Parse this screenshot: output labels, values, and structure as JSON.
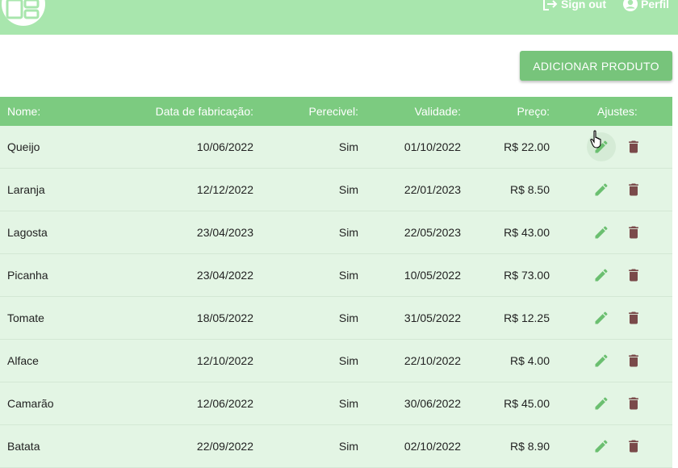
{
  "header": {
    "signout_label": "Sign out",
    "perfil_label": "Perfil",
    "colors": {
      "bar": "#a8e6ad",
      "accent": "#77c47b"
    }
  },
  "toolbar": {
    "add_label": "ADICIONAR PRODUTO"
  },
  "table": {
    "headers": {
      "nome": "Nome:",
      "fabricacao": "Data de fabricação:",
      "perecivel": "Perecivel:",
      "validade": "Validade:",
      "preco": "Preço:",
      "ajustes": "Ajustes:"
    },
    "rows": [
      {
        "nome": "Queijo",
        "fabricacao": "10/06/2022",
        "perecivel": "Sim",
        "validade": "01/10/2022",
        "preco": "R$ 22.00"
      },
      {
        "nome": "Laranja",
        "fabricacao": "12/12/2022",
        "perecivel": "Sim",
        "validade": "22/01/2023",
        "preco": "R$ 8.50"
      },
      {
        "nome": "Lagosta",
        "fabricacao": "23/04/2023",
        "perecivel": "Sim",
        "validade": "22/05/2023",
        "preco": "R$ 43.00"
      },
      {
        "nome": "Picanha",
        "fabricacao": "23/04/2022",
        "perecivel": "Sim",
        "validade": "10/05/2022",
        "preco": "R$ 73.00"
      },
      {
        "nome": "Tomate",
        "fabricacao": "18/05/2022",
        "perecivel": "Sim",
        "validade": "31/05/2022",
        "preco": "R$ 12.25"
      },
      {
        "nome": "Alface",
        "fabricacao": "12/10/2022",
        "perecivel": "Sim",
        "validade": "22/10/2022",
        "preco": "R$ 4.00"
      },
      {
        "nome": "Camarão",
        "fabricacao": "12/06/2022",
        "perecivel": "Sim",
        "validade": "30/06/2022",
        "preco": "R$ 45.00"
      },
      {
        "nome": "Batata",
        "fabricacao": "22/09/2022",
        "perecivel": "Sim",
        "validade": "02/10/2022",
        "preco": "R$ 8.90"
      }
    ],
    "icons": {
      "edit": "pencil-icon",
      "delete": "trash-icon"
    },
    "icon_colors": {
      "edit": "#6bbf70",
      "delete": "#7a4a4a"
    }
  }
}
